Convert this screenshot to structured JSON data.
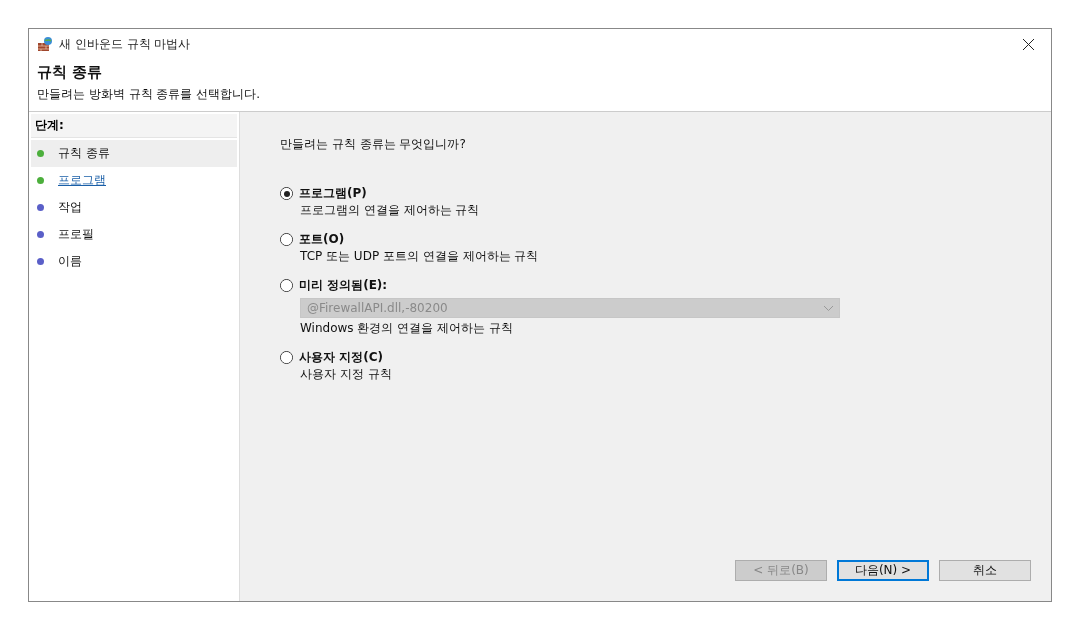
{
  "window": {
    "title": "새 인바운드 규칙 마법사"
  },
  "header": {
    "title": "규칙 종류",
    "subtitle": "만들려는 방화벽 규칙 종류를 선택합니다."
  },
  "steps": {
    "heading": "단계:",
    "items": [
      {
        "label": "규칙 종류",
        "selected": true,
        "hovered": false,
        "color": "#4caf3c"
      },
      {
        "label": "프로그램",
        "selected": false,
        "hovered": true,
        "color": "#4caf3c"
      },
      {
        "label": "작업",
        "selected": false,
        "hovered": false,
        "color": "#5a5fc8"
      },
      {
        "label": "프로필",
        "selected": false,
        "hovered": false,
        "color": "#5a5fc8"
      },
      {
        "label": "이름",
        "selected": false,
        "hovered": false,
        "color": "#5a5fc8"
      }
    ]
  },
  "question": "만들려는 규칙 종류는 무엇입니까?",
  "options": [
    {
      "label": "프로그램(P)",
      "description": "프로그램의 연결을 제어하는 규칙",
      "selected": true
    },
    {
      "label": "포트(O)",
      "description": "TCP 또는 UDP 포트의 연결을 제어하는 규칙",
      "selected": false
    },
    {
      "label": "미리 정의됨(E):",
      "description": "Windows 환경의 연결을 제어하는 규칙",
      "selected": false,
      "dropdown": {
        "value": "@FirewallAPI.dll,-80200",
        "disabled": true
      }
    },
    {
      "label": "사용자 지정(C)",
      "description": "사용자 지정 규칙",
      "selected": false
    }
  ],
  "buttons": [
    {
      "label": "< 뒤로(B)",
      "disabled": true,
      "default": false
    },
    {
      "label": "다음(N) >",
      "disabled": false,
      "default": true
    },
    {
      "label": "취소",
      "disabled": false,
      "default": false
    }
  ]
}
